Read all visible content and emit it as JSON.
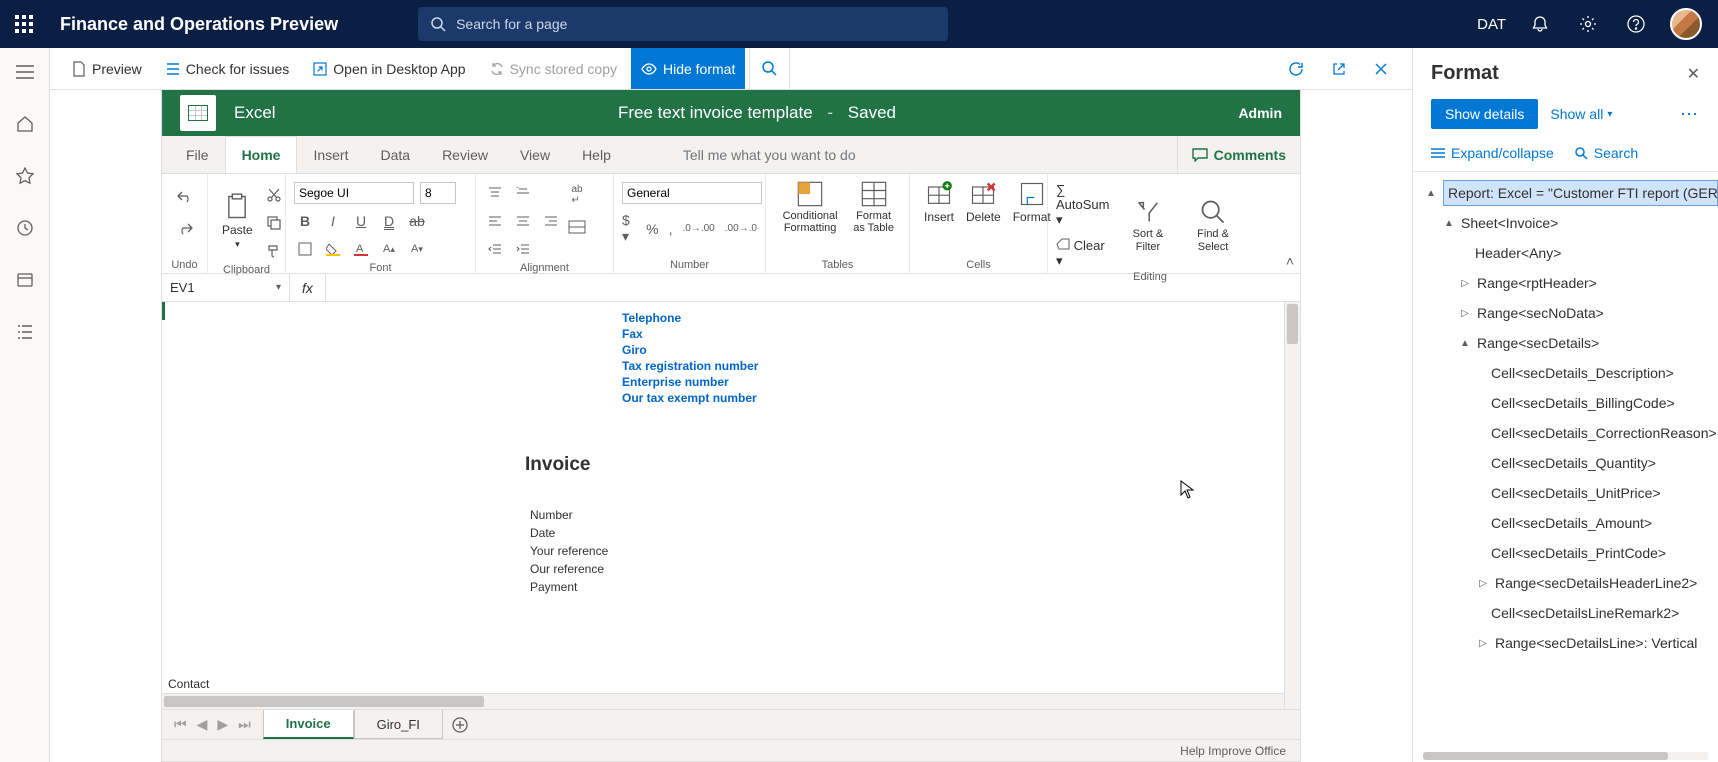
{
  "topbar": {
    "title": "Finance and Operations Preview",
    "search_placeholder": "Search for a page",
    "company": "DAT"
  },
  "cmdbar": {
    "preview": "Preview",
    "check": "Check for issues",
    "open_desktop": "Open in Desktop App",
    "sync": "Sync stored copy",
    "hide_format": "Hide format"
  },
  "excel": {
    "app": "Excel",
    "doc": "Free text invoice template",
    "status": "Saved",
    "user": "Admin",
    "tabs": [
      "File",
      "Home",
      "Insert",
      "Data",
      "Review",
      "View",
      "Help"
    ],
    "tellme": "Tell me what you want to do",
    "comments": "Comments",
    "font_name": "Segoe UI",
    "font_size": "8",
    "num_format": "General",
    "autosum": "AutoSum",
    "clear": "Clear",
    "groups": {
      "undo": "Undo",
      "clipboard": "Clipboard",
      "font": "Font",
      "alignment": "Alignment",
      "number": "Number",
      "tables": "Tables",
      "cells": "Cells",
      "editing": "Editing"
    },
    "big": {
      "paste": "Paste",
      "cond": "Conditional Formatting",
      "astable": "Format as Table",
      "insert": "Insert",
      "delete": "Delete",
      "format": "Format",
      "sort": "Sort & Filter",
      "find": "Find & Select"
    },
    "namebox": "EV1",
    "sheet_tabs": [
      "Invoice",
      "Giro_FI"
    ],
    "status_help": "Help Improve Office"
  },
  "doc": {
    "links": [
      "Telephone",
      "Fax",
      "Giro",
      "Tax registration number",
      "Enterprise number",
      "Our tax exempt number"
    ],
    "heading": "Invoice",
    "fields": [
      "Number",
      "Date",
      "Your reference",
      "Our reference",
      "Payment"
    ],
    "contact": "Contact"
  },
  "panel": {
    "title": "Format",
    "show_details": "Show details",
    "show_all": "Show all",
    "expand": "Expand/collapse",
    "search": "Search",
    "tree": {
      "root": "Report: Excel = \"Customer FTI report (GER)\" ",
      "sheet": "Sheet<Invoice>",
      "items": [
        "Header<Any>",
        "Range<rptHeader>",
        "Range<secNoData>",
        "Range<secDetails>"
      ],
      "details": [
        "Cell<secDetails_Description>",
        "Cell<secDetails_BillingCode>",
        "Cell<secDetails_CorrectionReason>",
        "Cell<secDetails_Quantity>",
        "Cell<secDetails_UnitPrice>",
        "Cell<secDetails_Amount>",
        "Cell<secDetails_PrintCode>",
        "Range<secDetailsHeaderLine2>",
        "Cell<secDetailsLineRemark2>",
        "Range<secDetailsLine>: Vertical"
      ]
    }
  }
}
